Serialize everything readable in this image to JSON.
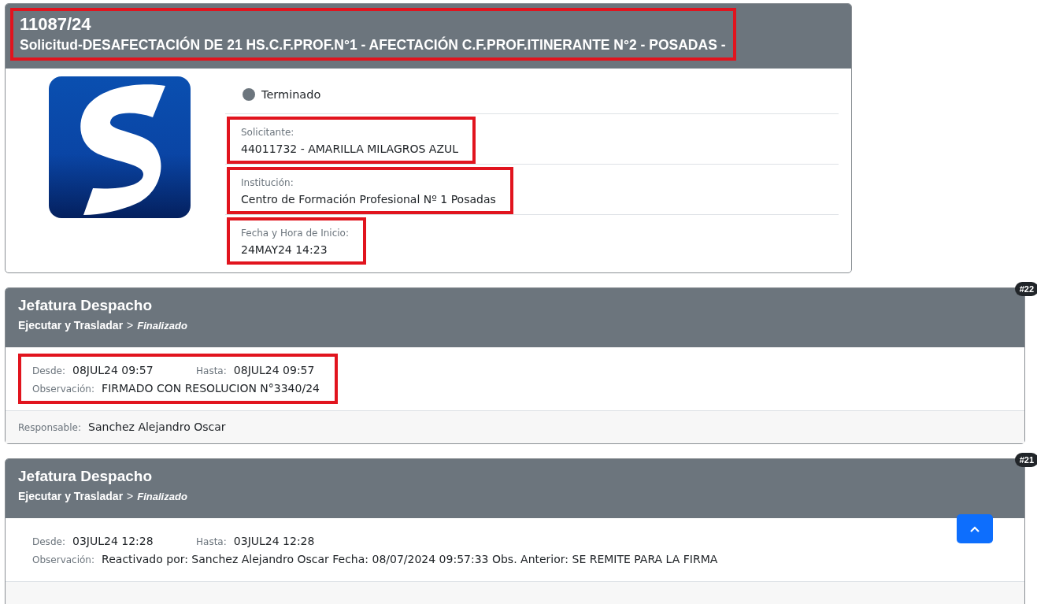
{
  "expediente": {
    "number": "11087/24",
    "subject": "Solicitud-DESAFECTACIÓN DE 21 HS.C.F.PROF.N°1 - AFECTACIÓN C.F.PROF.ITINERANTE N°2 - POSADAS -",
    "highlighted": true,
    "status": {
      "label": "Terminado",
      "color": "#6c757d"
    },
    "fields": [
      {
        "label": "Solicitante:",
        "value": "44011732 - AMARILLA MILAGROS AZUL",
        "highlighted": true
      },
      {
        "label": "Institución:",
        "value": "Centro de Formación Profesional Nº 1 Posadas",
        "highlighted": true
      },
      {
        "label": "Fecha y Hora de Inicio:",
        "value": "24MAY24 14:23",
        "highlighted": true
      }
    ]
  },
  "stages": [
    {
      "badge": "#22",
      "title": "Jefatura Despacho",
      "action": "Ejecutar y Trasladar",
      "arrow": ">",
      "state": "Finalizado",
      "desde_label": "Desde:",
      "desde": "08JUL24 09:57",
      "hasta_label": "Hasta:",
      "hasta": "08JUL24 09:57",
      "obs_label": "Observación:",
      "obs": "FIRMADO CON RESOLUCION N°3340/24",
      "highlighted": true,
      "responsable_label": "Responsable:",
      "responsable": "Sanchez Alejandro Oscar"
    },
    {
      "badge": "#21",
      "title": "Jefatura Despacho",
      "action": "Ejecutar y Trasladar",
      "arrow": ">",
      "state": "Finalizado",
      "desde_label": "Desde:",
      "desde": "03JUL24 12:28",
      "hasta_label": "Hasta:",
      "hasta": "03JUL24 12:28",
      "obs_label": "Observación:",
      "obs": "Reactivado por: Sanchez Alejandro Oscar Fecha: 08/07/2024 09:57:33 Obs. Anterior: SE REMITE PARA LA FIRMA",
      "highlighted": false
    }
  ]
}
